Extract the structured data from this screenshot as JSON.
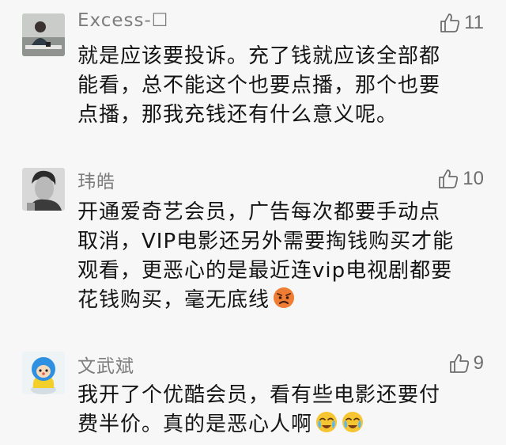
{
  "comments": [
    {
      "username": "Excess-☐",
      "likes": "11",
      "lines": [
        "就是应该要投诉。充了钱就应该全部都",
        "能看，总不能这个也要点播，那个也要",
        "点播，那我充钱还有什么意义呢。"
      ],
      "avatar_icon": "person-photo-avatar",
      "like_icon": "thumbs-up-icon"
    },
    {
      "username": "玮皓",
      "likes": "10",
      "lines": [
        "开通爱奇艺会员，广告每次都要手动点",
        "取消，VIP电影还另外需要掏钱购买才能",
        "观看，更恶心的是最近连vip电视剧都要",
        "花钱购买，毫无底线"
      ],
      "avatar_icon": "person-photo-avatar",
      "like_icon": "thumbs-up-icon",
      "trailing_emoji": "angry-face-emoji"
    },
    {
      "username": "文武斌",
      "likes": "9",
      "lines": [
        "我开了个优酷会员，看有些电影还要付",
        "费半价。真的是恶心人啊"
      ],
      "avatar_icon": "cartoon-character-avatar",
      "like_icon": "thumbs-up-icon",
      "trailing_emoji": "crying-face-emoji"
    }
  ],
  "colors": {
    "background": "#f7f7f7",
    "username": "#7d7d7d",
    "body_text": "#141414",
    "like_count": "#6e6e6e"
  }
}
